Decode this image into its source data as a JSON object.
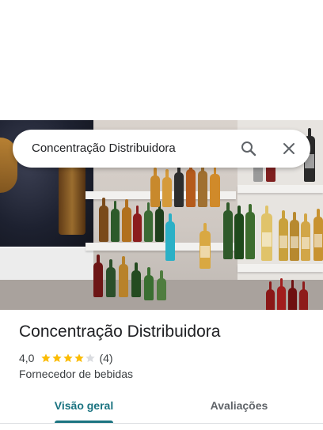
{
  "search": {
    "query": "Concentração Distribuidora",
    "search_icon": "search-icon",
    "close_icon": "close-icon"
  },
  "photo": {
    "description_icon": "store-photo"
  },
  "place": {
    "title": "Concentração Distribuidora",
    "rating": "4,0",
    "stars_filled": 4,
    "stars_total": 5,
    "review_count": "(4)",
    "category": "Fornecedor de bebidas"
  },
  "tabs": [
    {
      "label": "Visão geral",
      "selected": true
    },
    {
      "label": "Avaliações",
      "selected": false
    }
  ],
  "colors": {
    "accent": "#1a7380",
    "star": "#fbbc04",
    "star_empty": "#dadce0",
    "text_primary": "#202124",
    "text_secondary": "#3c4043"
  }
}
